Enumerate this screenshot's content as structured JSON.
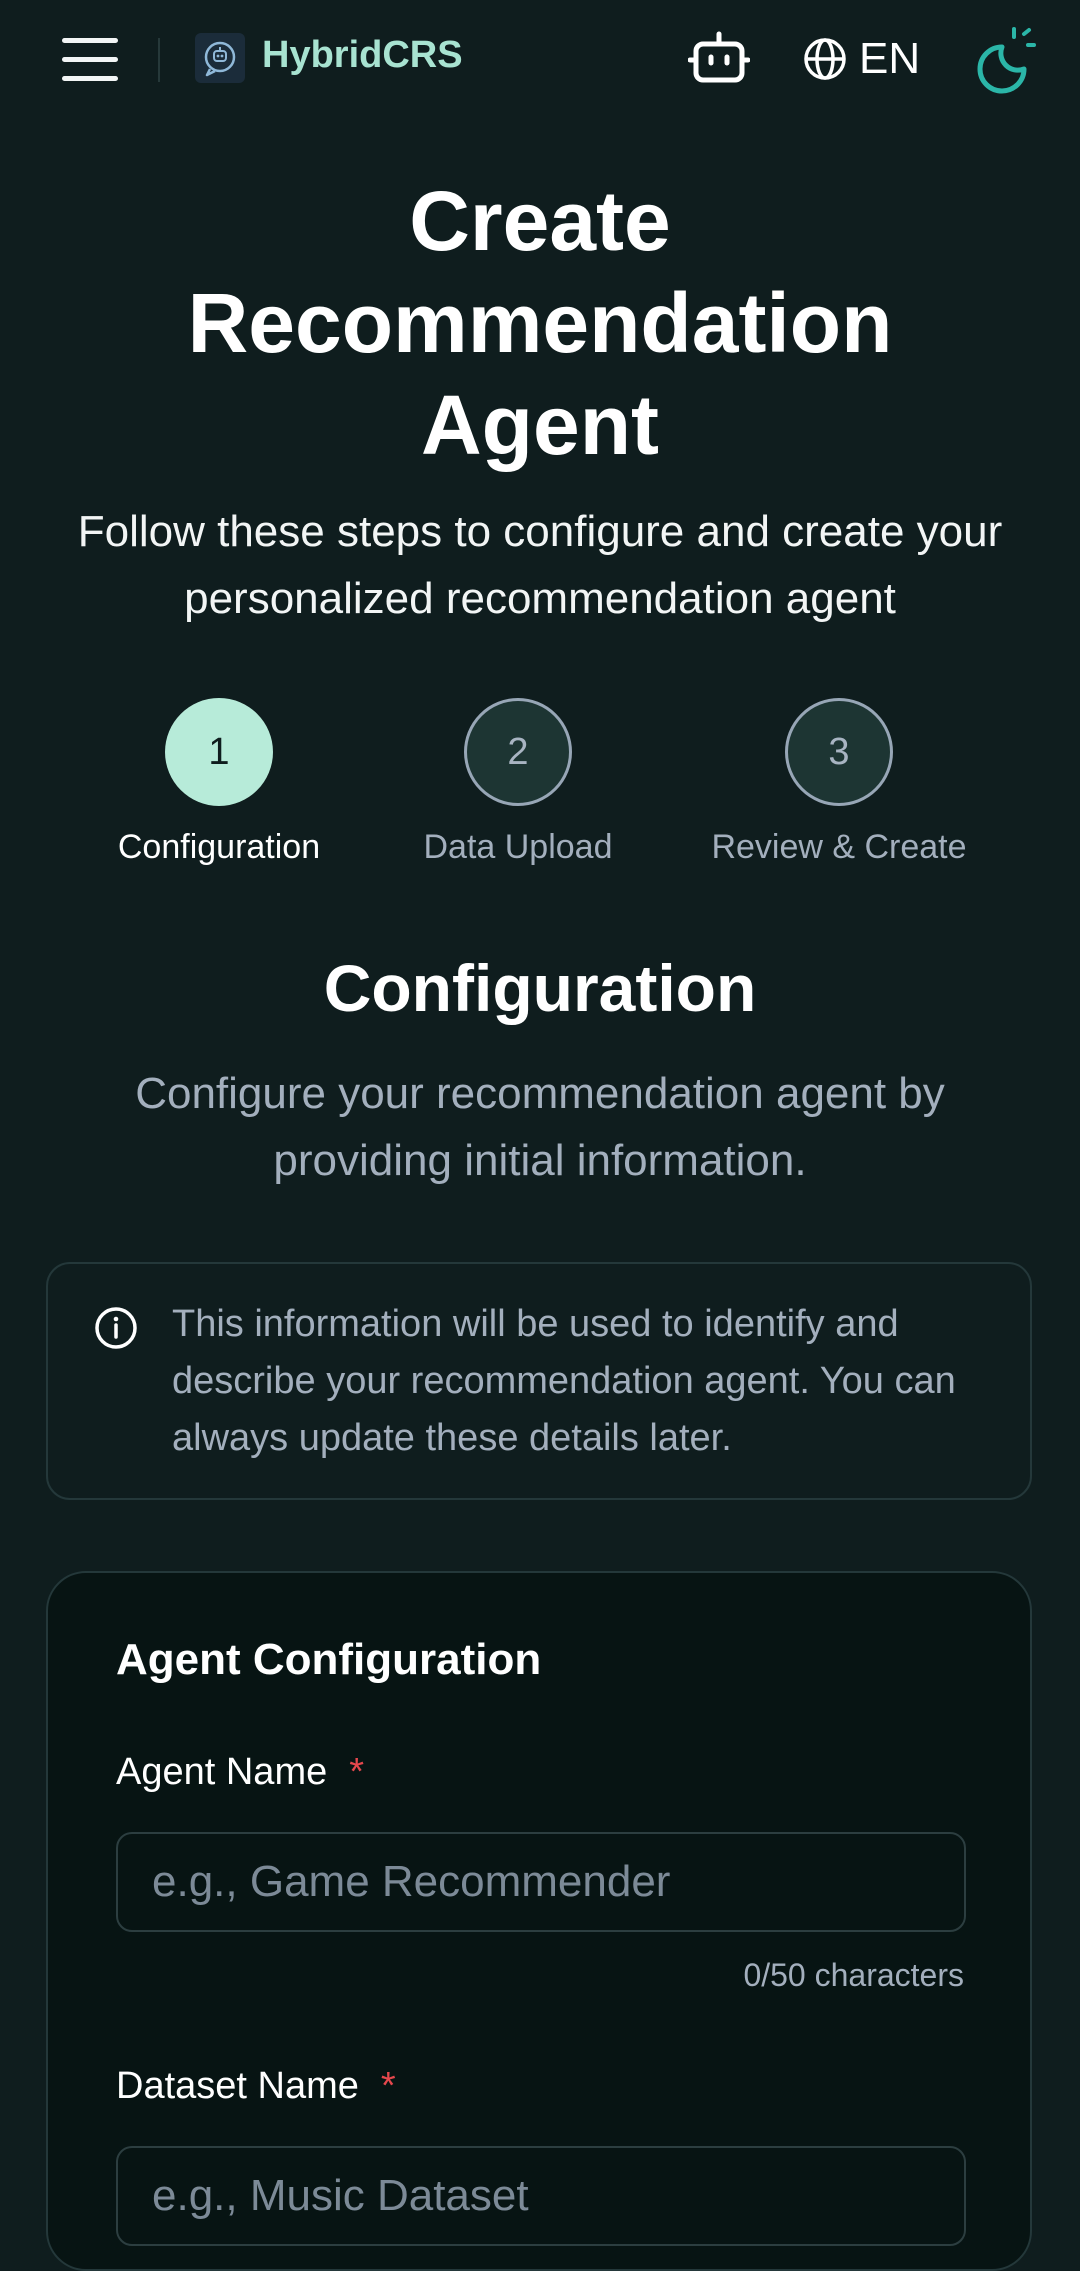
{
  "header": {
    "brand": "HybridCRS",
    "language": "EN"
  },
  "hero": {
    "title": "Create Recommendation Agent",
    "subtitle": "Follow these steps to configure and create your personalized recommendation agent"
  },
  "steps": [
    {
      "number": "1",
      "label": "Configuration",
      "state": "active"
    },
    {
      "number": "2",
      "label": "Data Upload",
      "state": "idle"
    },
    {
      "number": "3",
      "label": "Review & Create",
      "state": "idle"
    }
  ],
  "section": {
    "title": "Configuration",
    "description": "Configure your recommendation agent by providing initial information."
  },
  "info": {
    "text": "This information will be used to identify and describe your recommendation agent. You can always update these details later."
  },
  "form": {
    "title": "Agent Configuration",
    "agent_name": {
      "label": "Agent Name",
      "required_mark": "*",
      "placeholder": "e.g., Game Recommender",
      "value": "",
      "counter": "0/50 characters"
    },
    "dataset_name": {
      "label": "Dataset Name",
      "required_mark": "*",
      "placeholder": "e.g., Music Dataset",
      "value": ""
    }
  },
  "colors": {
    "background": "#0f1d1e",
    "accent": "#a8e3d1",
    "active_step": "#b7ebd9",
    "theme_icon": "#2bb6a8",
    "required": "#e5484d"
  },
  "icons": [
    "menu-icon",
    "logo-icon",
    "robot-icon",
    "globe-icon",
    "theme-toggle-icon",
    "info-icon"
  ]
}
